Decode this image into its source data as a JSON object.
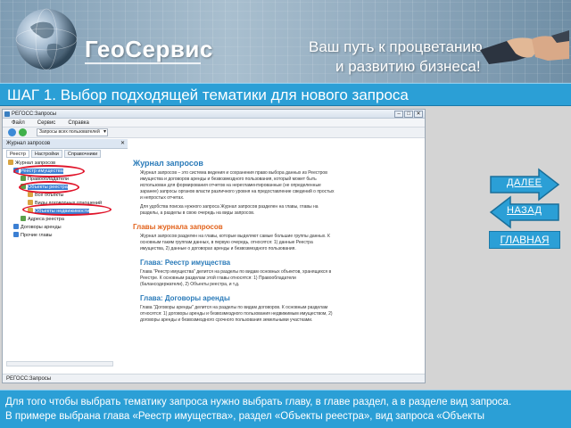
{
  "banner": {
    "logo": "ГеоСервис",
    "slogan_line1": "Ваш путь к процветанию",
    "slogan_line2": "и развитию бизнеса!"
  },
  "step_title": "ШАГ 1. Выбор подходящей тематики для нового запроса",
  "app": {
    "title": "РЕГОСС:Запросы",
    "menu": [
      "Файл",
      "Сервис",
      "Справка"
    ],
    "toolbar_combo": "Запросы всех пользователей",
    "panel_title": "Журнал запросов",
    "tabs": [
      "Реестр",
      "Настройки",
      "Справочники"
    ],
    "tree": [
      "Журнал запросов",
      "Реестр имущества",
      "Правообладатели",
      "Объекты реестра",
      "Все объекты",
      "Виды договорных отношений",
      "Объекты недвижимости",
      "Адреса реестра",
      "Договоры аренды",
      "Прочие главы"
    ],
    "content": {
      "title": "Журнал запросов",
      "intro": "Журнал запросов – это система ведения и сохранения право выбора данных из Реестров имущества и договоров аренды и безвозмездного пользования, который может быть использован для формирования отчетов на нерегламентированные (не определенные заранее) запросы органов власти различного уровня на предоставление сведений о простых и непростых отчетах.",
      "intro2": "Для удобства поиска нужного запроса Журнал запросов разделен на главы, главы на разделы, а разделы в свою очередь на виды запросов.",
      "h_chapters": "Главы журнала запросов",
      "chapters_text": "Журнал запросов разделен на главы, которые выделяют самые большие группы данных. К основным таким группам данных, в первую очередь, относятся: 1) данные Реестра имущества, 2) данные о договорах аренды и безвозмездного пользования.",
      "h_registry": "Глава: Реестр имущества",
      "registry_text": "Глава \"Реестр имущества\" делится на разделы по видам основных объектов, хранящихся в Реестре. К основным разделам этой главы относятся: 1) Правообладатели (балансодержатели), 2) Объекты реестра, и т.д.",
      "h_leases": "Глава: Договоры аренды",
      "leases_text": "Глава \"Договоры аренды\" делится на разделы по видам договоров. К основным разделам относятся: 1) договоры аренды и безвозмездного пользования недвижимым имуществом, 2) договоры аренды и безвозмездного срочного пользования земельными участками."
    },
    "status": "РЕГОСС:Запросы"
  },
  "nav": {
    "main": "ГЛАВНАЯ",
    "next": "ДАЛЕЕ",
    "back": "НАЗАД"
  },
  "footer": {
    "line1": "Для того чтобы выбрать тематику запроса нужно выбрать главу, в главе раздел, а в разделе вид запроса.",
    "line2": "В примере выбрана глава «Реестр имущества», раздел «Объекты реестра», вид запроса «Объекты"
  }
}
